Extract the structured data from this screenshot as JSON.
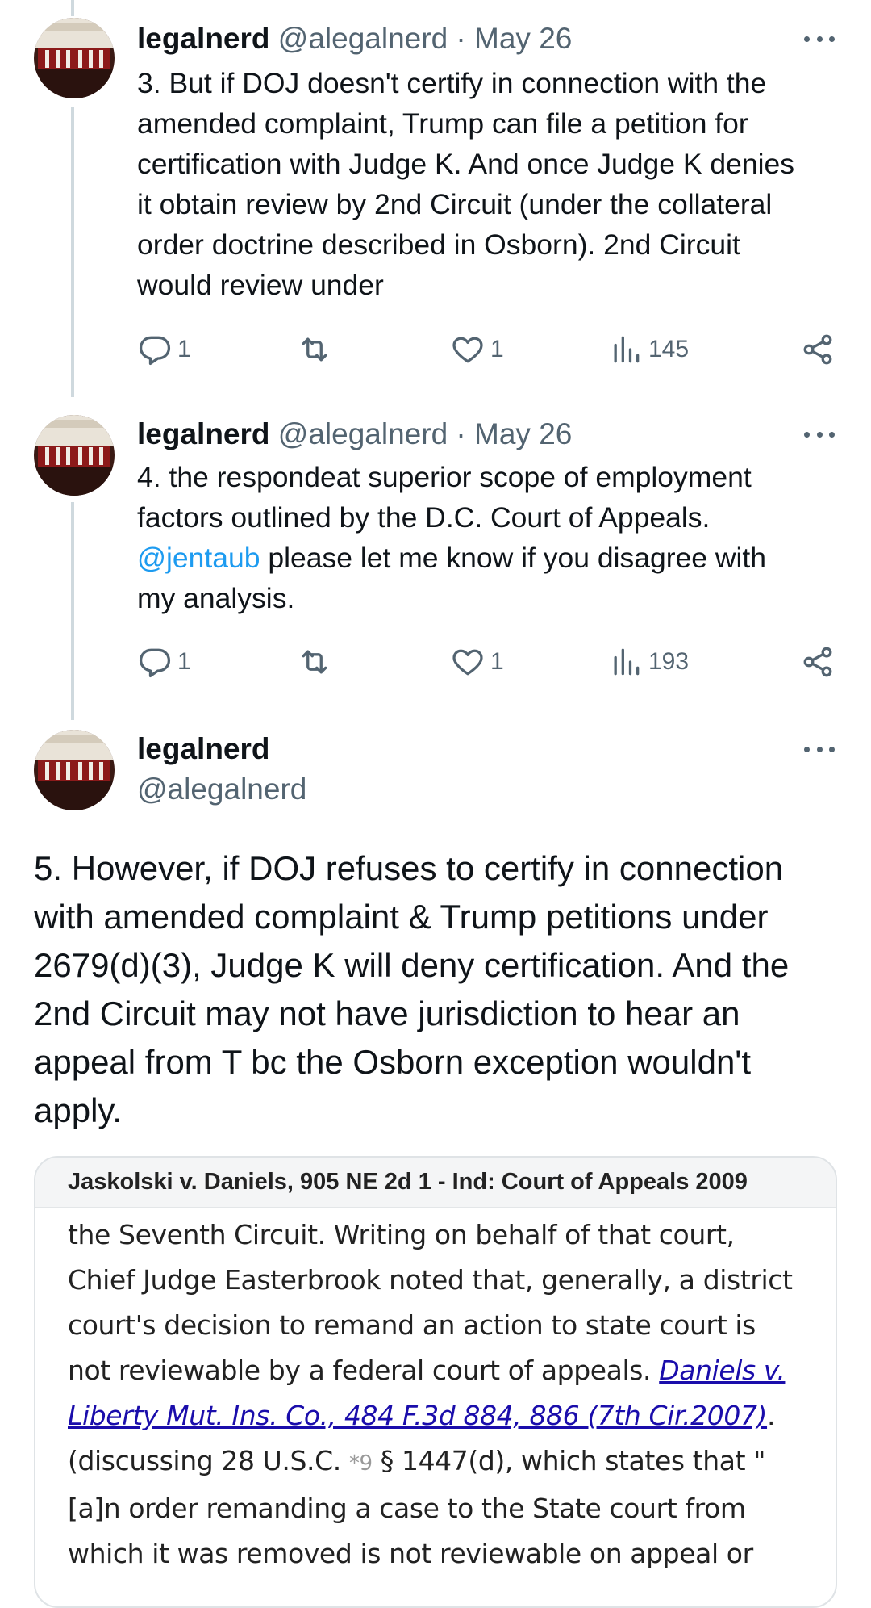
{
  "tweets": [
    {
      "name": "legalnerd",
      "meta": "@alegalnerd · May 26",
      "lines": [
        "3. But if DOJ doesn't certify in connection with the",
        "amended complaint, Trump can file a petition for",
        "certification with Judge K. And once Judge K denies",
        "it obtain review by 2nd Circuit (under the collateral",
        "order doctrine described in Osborn). 2nd Circuit",
        "would review under"
      ],
      "replies": "1",
      "retweets": "",
      "likes": "1",
      "views": "145"
    },
    {
      "name": "legalnerd",
      "meta": "@alegalnerd · May 26",
      "line1": "4. the respondeat superior scope of employment",
      "line2": "factors outlined by the D.C. Court of Appeals.",
      "mention": "@jentaub",
      "line3_rest": " please let me know if you disagree with",
      "line4": "my analysis.",
      "replies": "1",
      "retweets": "",
      "likes": "1",
      "views": "193"
    }
  ],
  "main_tweet": {
    "name": "legalnerd",
    "handle": "@alegalnerd",
    "lines": [
      "5. However, if DOJ refuses to certify in connection",
      "with amended complaint & Trump petitions under",
      "2679(d)(3), Judge K will deny certification. And the",
      "2nd Circuit may not have jurisdiction to hear an",
      "appeal from T bc the Osborn exception wouldn't",
      "apply."
    ]
  },
  "card": {
    "header": "Jaskolski v. Daniels, 905 NE 2d 1 - Ind: Court of Appeals 2009",
    "l1": "the Seventh Circuit. Writing on behalf of that court,",
    "l2": "Chief Judge Easterbrook noted that, generally, a district",
    "l3": "court's decision to remand an action to state court is",
    "l4_text": "not reviewable by a federal court of appeals. ",
    "l4_link": "Daniels v.",
    "l5_link": "Liberty Mut. Ins. Co., 484 F.3d 884, 886 (7th Cir.2007)",
    "l5_rest": ".",
    "l6_a": "(discussing 28 U.S.C. ",
    "l6_pg": "*9",
    "l6_b": " § 1447(d), which states that \"",
    "l7": "[a]n order remanding a case to the State court from",
    "l8": "which it was removed is not reviewable on appeal or"
  }
}
